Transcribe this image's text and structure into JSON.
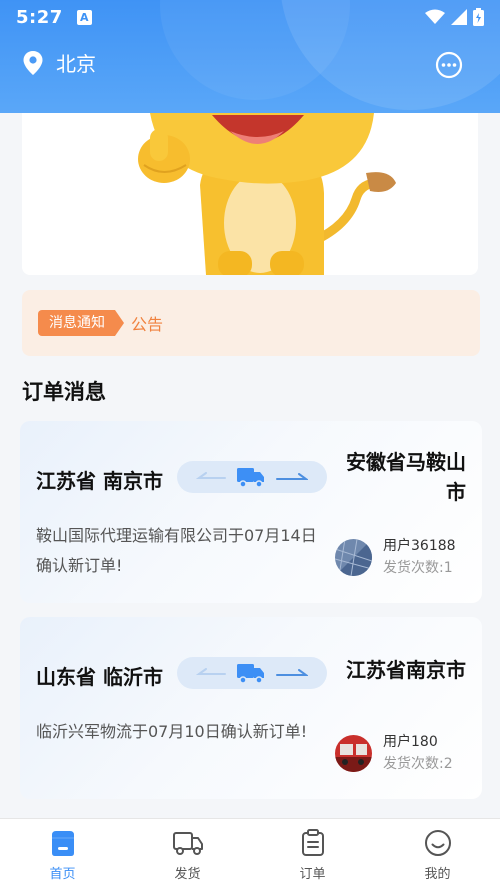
{
  "status_bar": {
    "time": "5:27",
    "a_badge": "A"
  },
  "header": {
    "city": "北京",
    "location_icon": "location-pin-icon",
    "message_icon": "chat-bubble-icon"
  },
  "banner": {
    "image": "cartoon-lion-mascot"
  },
  "notice": {
    "tag": "消息通知",
    "text": "公告"
  },
  "section": {
    "title": "订单消息"
  },
  "orders": [
    {
      "from": "江苏省 南京市",
      "to": "安徽省马鞍山市",
      "description": "鞍山国际代理运输有限公司于07月14日确认新订单!",
      "user": "用户36188",
      "count_label": "发货次数:",
      "count": "1"
    },
    {
      "from": "山东省 临沂市",
      "to": "江苏省南京市",
      "description": "临沂兴军物流于07月10日确认新订单!",
      "user": "用户180",
      "count_label": "发货次数:",
      "count": "2"
    }
  ],
  "tabbar": {
    "active": "home",
    "items": [
      {
        "label": "首页",
        "icon": "home-icon"
      },
      {
        "label": "发货",
        "icon": "truck-icon"
      },
      {
        "label": "订单",
        "icon": "clipboard-icon"
      },
      {
        "label": "我的",
        "icon": "smiley-icon"
      }
    ]
  },
  "colors": {
    "primary": "#3f93f5",
    "notice_tag": "#f58b4c",
    "notice_text": "#f0823f",
    "tab_active": "#3a8ef6"
  }
}
